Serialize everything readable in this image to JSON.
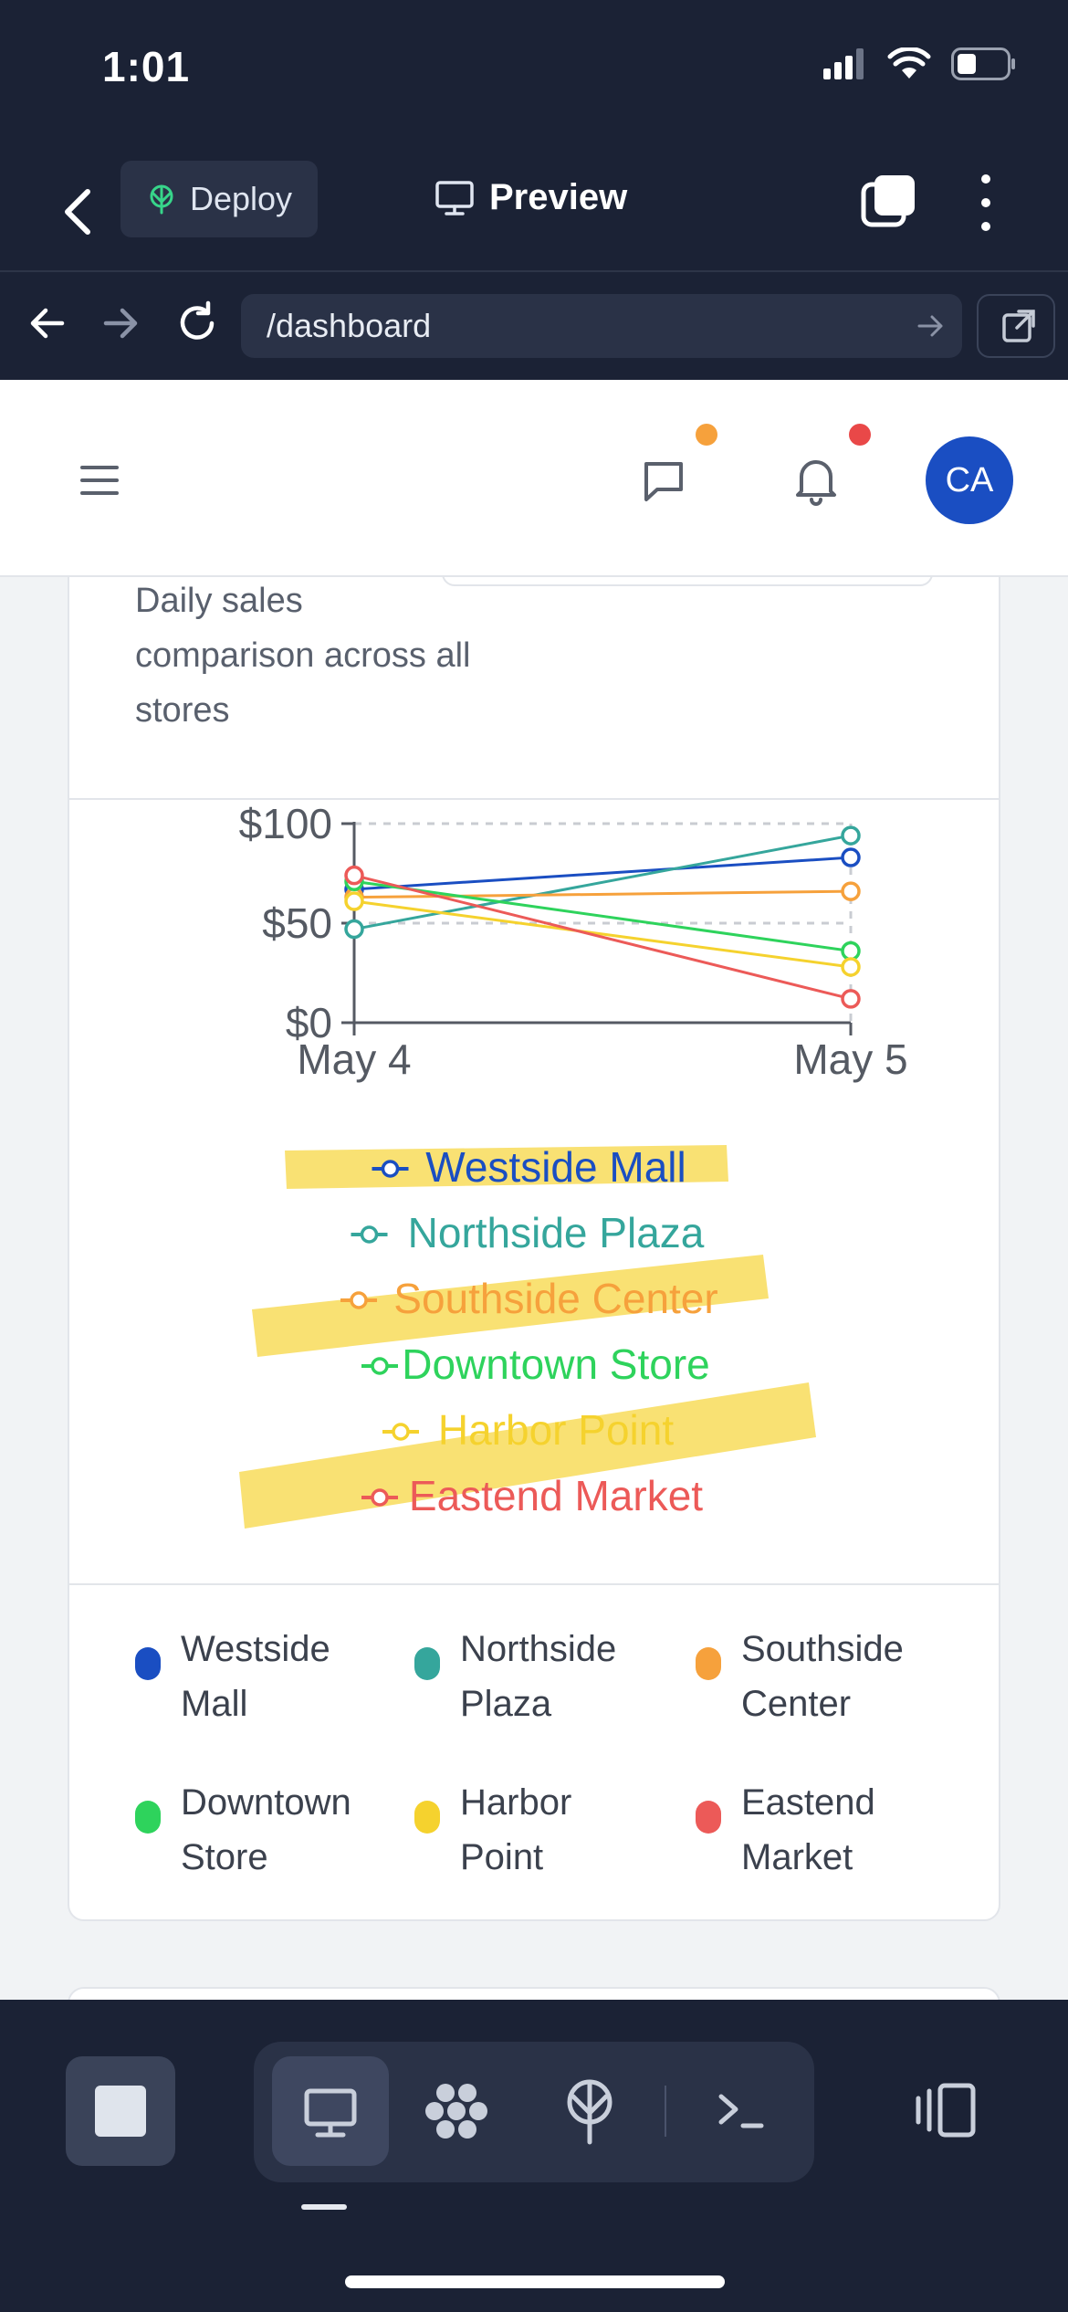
{
  "status_bar": {
    "time": "1:01"
  },
  "toolbar": {
    "deploy_label": "Deploy",
    "title": "Preview"
  },
  "browser": {
    "url": "/dashboard"
  },
  "header": {
    "avatar_initials": "CA"
  },
  "card": {
    "description": "Daily sales comparison across all stores"
  },
  "chart_data": {
    "type": "line",
    "x": [
      "May 4",
      "May 5"
    ],
    "y_ticks": [
      "$0",
      "$50",
      "$100"
    ],
    "ylim": [
      0,
      100
    ],
    "grid": "dashed horizontal",
    "legend": "bottom",
    "series": [
      {
        "name": "Westside Mall",
        "color": "#1a4ec2",
        "values": [
          67,
          83
        ]
      },
      {
        "name": "Northside Plaza",
        "color": "#35a69c",
        "values": [
          47,
          94
        ]
      },
      {
        "name": "Southside Center",
        "color": "#f6a13c",
        "values": [
          63,
          66
        ]
      },
      {
        "name": "Downtown Store",
        "color": "#2ed35c",
        "values": [
          71,
          36
        ]
      },
      {
        "name": "Harbor Point",
        "color": "#f5d22e",
        "values": [
          61,
          28
        ]
      },
      {
        "name": "Eastend Market",
        "color": "#ec5a58",
        "values": [
          74,
          12
        ]
      }
    ]
  },
  "legend_grid": [
    {
      "line1": "Westside",
      "line2": "Mall",
      "color": "#1a4ec2"
    },
    {
      "line1": "Northside",
      "line2": "Plaza",
      "color": "#35a69c"
    },
    {
      "line1": "Southside",
      "line2": "Center",
      "color": "#f6a13c"
    },
    {
      "line1": "Downtown",
      "line2": "Store",
      "color": "#2ed35c"
    },
    {
      "line1": "Harbor",
      "line2": "Point",
      "color": "#f5d22e"
    },
    {
      "line1": "Eastend",
      "line2": "Market",
      "color": "#ec5a58"
    }
  ]
}
